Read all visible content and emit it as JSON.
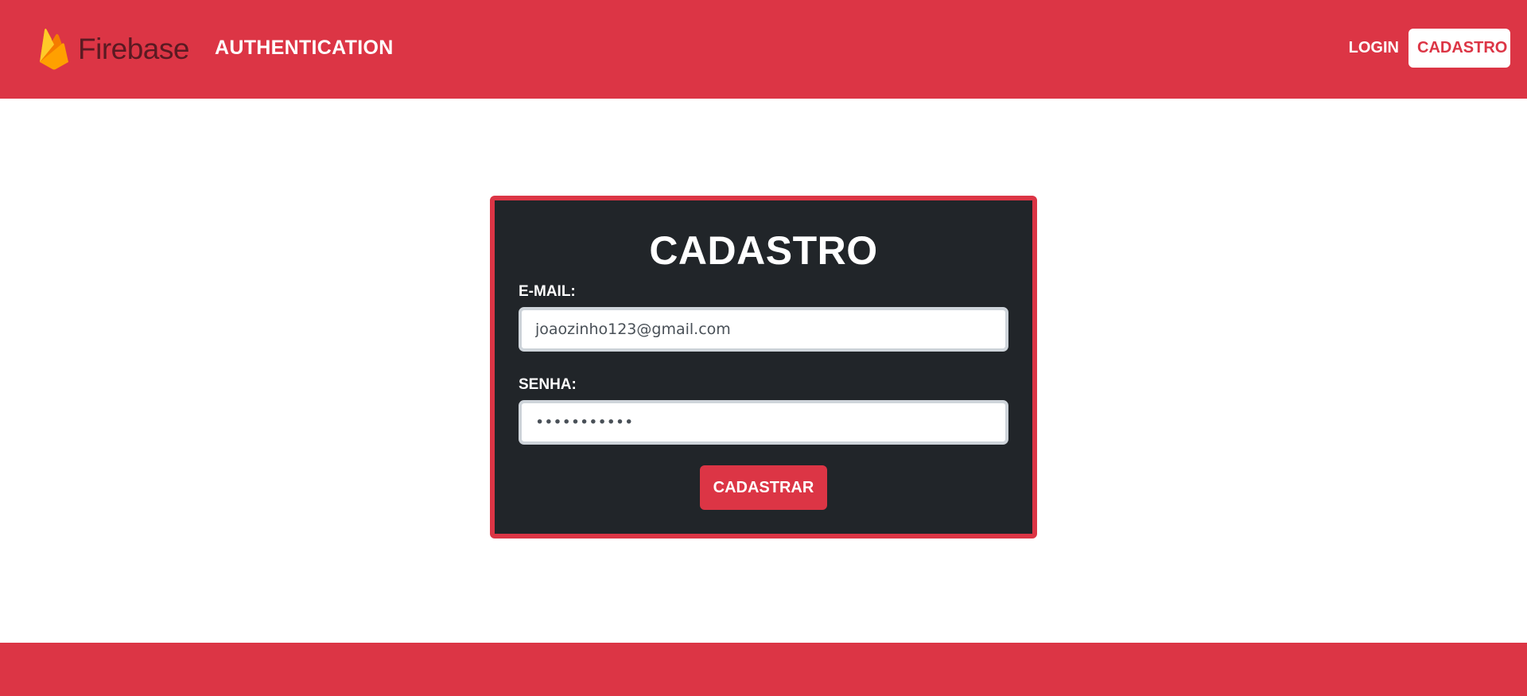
{
  "navbar": {
    "brand_name": "Firebase",
    "section_title": "AUTHENTICATION",
    "login_label": "LOGIN",
    "cadastro_label": "CADASTRO"
  },
  "form": {
    "title": "CADASTRO",
    "email_label": "E-MAIL:",
    "email_value": "joaozinho123@gmail.com",
    "password_label": "SENHA:",
    "password_value": "•••••••••••",
    "submit_label": "CADASTRAR"
  },
  "icons": {
    "logo": "firebase-flame-icon"
  },
  "colors": {
    "primary": "#dc3545",
    "card_bg": "#212529",
    "white": "#ffffff",
    "input_border": "#ced4da"
  }
}
